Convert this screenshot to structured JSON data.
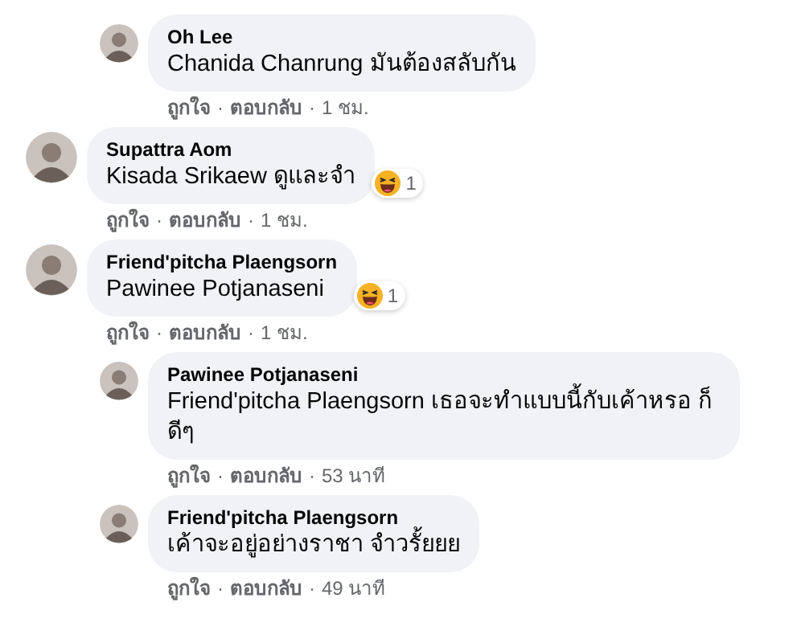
{
  "separator": "·",
  "loose_replies": [
    {
      "author": "Oh Lee",
      "text": "Chanida Chanrung มันต้องสลับกัน",
      "actions": {
        "like": "ถูกใจ",
        "reply": "ตอบกลับ",
        "time": "1 ชม."
      }
    }
  ],
  "comments": [
    {
      "author": "Supattra Aom",
      "text": "Kisada Srikaew ดูและจำ",
      "reaction": {
        "count": "1"
      },
      "actions": {
        "like": "ถูกใจ",
        "reply": "ตอบกลับ",
        "time": "1 ชม."
      }
    },
    {
      "author": "Friend'pitcha Plaengsorn",
      "text": "Pawinee Potjanaseni",
      "reaction": {
        "count": "1"
      },
      "actions": {
        "like": "ถูกใจ",
        "reply": "ตอบกลับ",
        "time": "1 ชม."
      },
      "children": [
        {
          "author": "Pawinee Potjanaseni",
          "text": "Friend'pitcha Plaengsorn เธอจะทำแบบนี้กับเค้าหรอ ก็ดีๆ",
          "actions": {
            "like": "ถูกใจ",
            "reply": "ตอบกลับ",
            "time": "53 นาที"
          }
        },
        {
          "author": "Friend'pitcha Plaengsorn",
          "text": "เค้าจะอยู่อย่างราชา จำวรั้ยยย",
          "actions": {
            "like": "ถูกใจ",
            "reply": "ตอบกลับ",
            "time": "49 นาที"
          }
        }
      ]
    }
  ]
}
